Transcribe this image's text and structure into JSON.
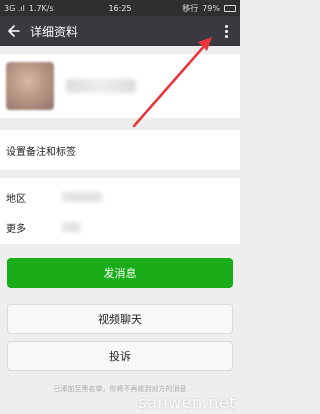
{
  "status_bar": {
    "left": "3G .ıl",
    "speed": "1.7K/s",
    "time": "16:25",
    "carrier": "移行",
    "battery_text": "79%",
    "battery_level": 0.79
  },
  "app_bar": {
    "title": "详细资料"
  },
  "profile": {},
  "rows": {
    "remark": "设置备注和标签",
    "region_label": "地区",
    "more_label": "更多"
  },
  "buttons": {
    "send_message": "发消息",
    "video_chat": "视频聊天",
    "report": "投诉"
  },
  "footer": "已添加至黑名单，你将不再收到对方的消息",
  "watermark": "sanwen.net",
  "colors": {
    "app_bar": "#393a3f",
    "primary": "#1aad19",
    "arrow": "#e8343a",
    "background": "#eeeeee"
  }
}
